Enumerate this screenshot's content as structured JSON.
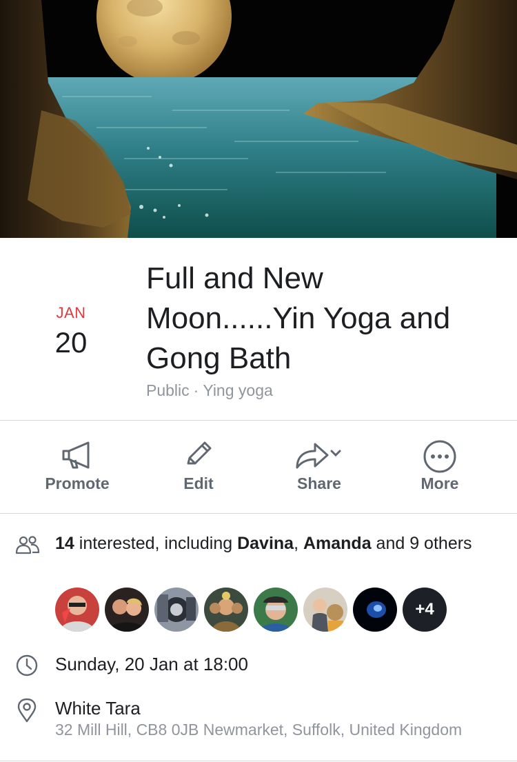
{
  "cover": {
    "image": "full-moon-over-sea-cove"
  },
  "event": {
    "month": "JAN",
    "day": "20",
    "title_lines": [
      "Full and New",
      "Moon......Yin Yoga and",
      "Gong Bath"
    ],
    "visibility": "Public",
    "separator": "·",
    "host": "Ying yoga"
  },
  "actions": [
    {
      "label": "Promote",
      "icon": "megaphone-icon"
    },
    {
      "label": "Edit",
      "icon": "pencil-icon"
    },
    {
      "label": "Share",
      "icon": "share-arrow-icon"
    },
    {
      "label": "More",
      "icon": "more-dots-icon"
    }
  ],
  "interested": {
    "count": "14",
    "text1": " interested, including ",
    "name1": "Davina",
    "comma": ", ",
    "name2": "Amanda",
    "text2": " and 9 others",
    "overflow_label": "+4"
  },
  "datetime": {
    "text": "Sunday, 20 Jan at 18:00"
  },
  "location": {
    "name": "White Tara",
    "address": "32 Mill Hill, CB8 0JB Newmarket, Suffolk, United Kingdom"
  },
  "colors": {
    "date_red": "#e0393e",
    "secondary_text": "#90949c",
    "action_text": "#606770",
    "divider": "#d3d6db"
  }
}
